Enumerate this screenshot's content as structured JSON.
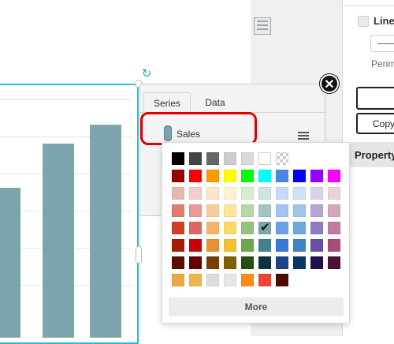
{
  "popup": {
    "tabs": [
      {
        "label": "Series",
        "active": true
      },
      {
        "label": "Data",
        "active": false
      }
    ],
    "series": {
      "name": "Sales",
      "color": "#7ca4ad"
    }
  },
  "palette": {
    "rows": [
      [
        "#000000",
        "#444444",
        "#666666",
        "#cccccc",
        "#d9d9d9",
        "#ffffff",
        "transparent"
      ],
      [
        "#990000",
        "#ff0000",
        "#ff9900",
        "#ffff00",
        "#00ff00",
        "#00ffff",
        "#4a86e8",
        "#0000ff",
        "#9900ff",
        "#ff00ff"
      ],
      [
        "#e6b8af",
        "#f4cccc",
        "#fce5cd",
        "#fff2cc",
        "#d9ead3",
        "#d0e0e3",
        "#c9daf8",
        "#cfe2f3",
        "#d9d2e9",
        "#ead1dc"
      ],
      [
        "#dd7e6b",
        "#ea9999",
        "#f9cb9c",
        "#ffe599",
        "#b6d7a8",
        "#a2c4c9",
        "#a4c2f4",
        "#9fc5e8",
        "#b4a7d6",
        "#d5a6bd"
      ],
      [
        "#cc4125",
        "#e06666",
        "#f6b26b",
        "#ffd966",
        "#93c47d",
        "#7ca4ad",
        "#6d9eeb",
        "#6fa8dc",
        "#8e7cc3",
        "#c27ba0"
      ],
      [
        "#a61c00",
        "#cc0000",
        "#e69138",
        "#f1c232",
        "#6aa84f",
        "#45818e",
        "#3c78d8",
        "#3d85c6",
        "#674ea7",
        "#a64d79"
      ],
      [
        "#5b0f00",
        "#660000",
        "#783f04",
        "#7f6000",
        "#274e13",
        "#0c343d",
        "#1c4587",
        "#073763",
        "#20124d",
        "#4c1130"
      ],
      [
        "#f0a741",
        "#eeb54f",
        "#dddddd",
        "#e6e6e6",
        "#ff8c1a",
        "#ee4433",
        "#4a0a00"
      ]
    ],
    "selected": {
      "row": 4,
      "col": 5
    },
    "more_label": "More"
  },
  "right_panel": {
    "line_label": "Line",
    "perimeter_label": "Perim",
    "copy_label": "Copy",
    "property_tab_label": "Property"
  },
  "chart_data": {
    "type": "bar",
    "values": [
      190,
      246,
      270
    ]
  }
}
